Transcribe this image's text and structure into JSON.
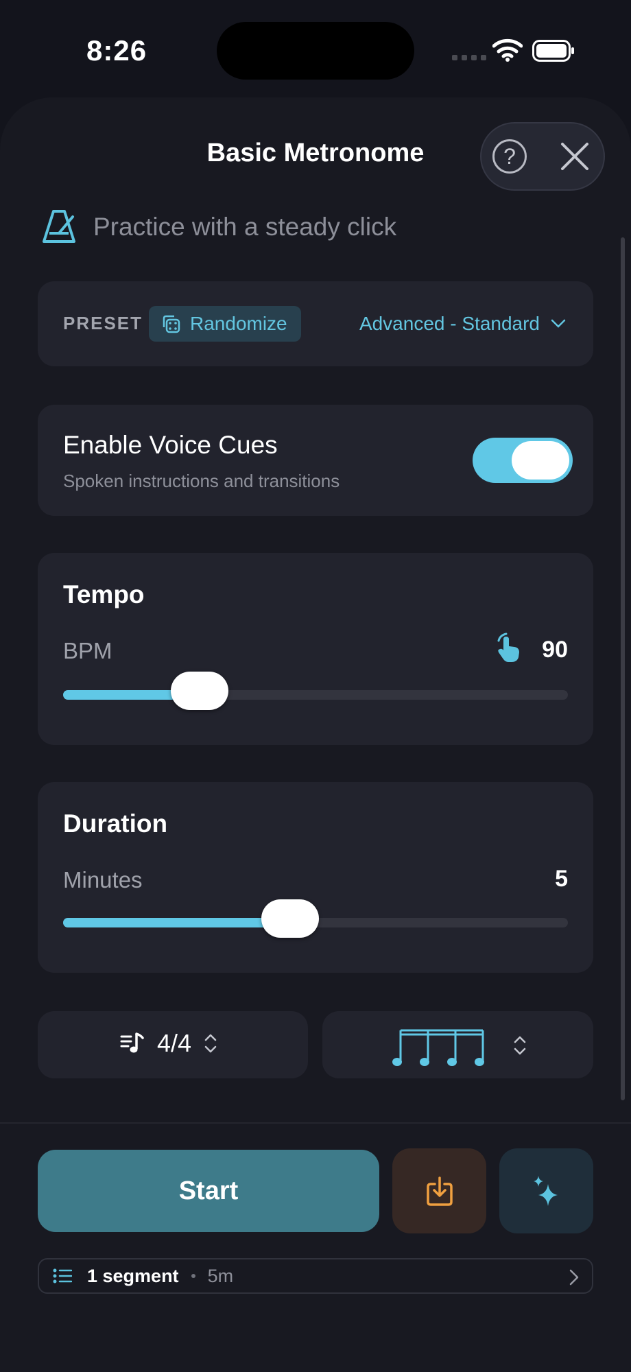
{
  "status_bar": {
    "time": "8:26"
  },
  "header": {
    "title": "Basic Metronome",
    "help_label": "?"
  },
  "subtitle": "Practice with a steady click",
  "preset": {
    "label": "PRESET",
    "randomize_label": "Randomize",
    "selected": "Advanced - Standard"
  },
  "voice_cues": {
    "title": "Enable Voice Cues",
    "description": "Spoken instructions and transitions",
    "enabled": true
  },
  "tempo": {
    "title": "Tempo",
    "label": "BPM",
    "value": "90",
    "slider_fraction": 0.27
  },
  "duration": {
    "title": "Duration",
    "label": "Minutes",
    "value": "5",
    "slider_fraction": 0.45
  },
  "time_signature": {
    "value": "4/4"
  },
  "subdivision": {
    "icon": "four-sixteenth-notes-icon"
  },
  "actions": {
    "start_label": "Start"
  },
  "segments": {
    "count_label": "1 segment",
    "duration_label": "5m"
  },
  "colors": {
    "accent": "#60c8e6",
    "start_button": "#3e7b8a",
    "import_icon": "#f0a040",
    "card_background": "#22232d"
  }
}
